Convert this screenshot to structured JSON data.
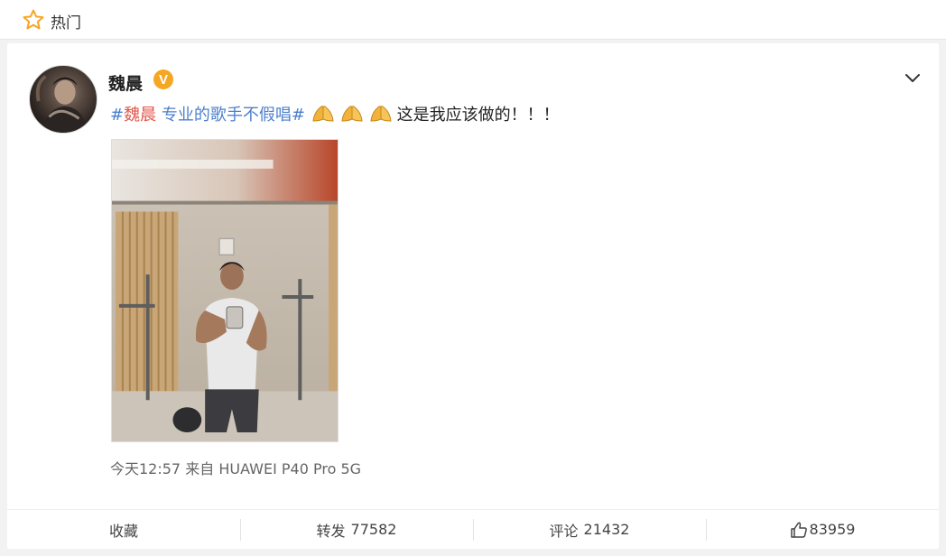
{
  "hot_bar": {
    "label": "热门"
  },
  "post": {
    "user": {
      "name": "魏晨",
      "verified_mark": "V"
    },
    "hashtag_prefix": "#",
    "hashtag_name": "魏晨",
    "hashtag_rest": " 专业的歌手不假唱#",
    "emoji_icon": "praying-hands-icon",
    "body": "这是我应该做的！！！",
    "time": "今天12:57",
    "source_prefix": "来自",
    "source_device": "HUAWEI P40 Pro 5G"
  },
  "actions": {
    "favorite_label": "收藏",
    "repost_label": "转发",
    "repost_count": "77582",
    "comment_label": "评论",
    "comment_count": "21432",
    "like_count": "83959"
  },
  "colors": {
    "hashtag_blue": "#4d7fcc",
    "hashtag_name_red": "#e2574c",
    "star_orange": "#f5a623",
    "verified_orange": "#f5a623"
  }
}
